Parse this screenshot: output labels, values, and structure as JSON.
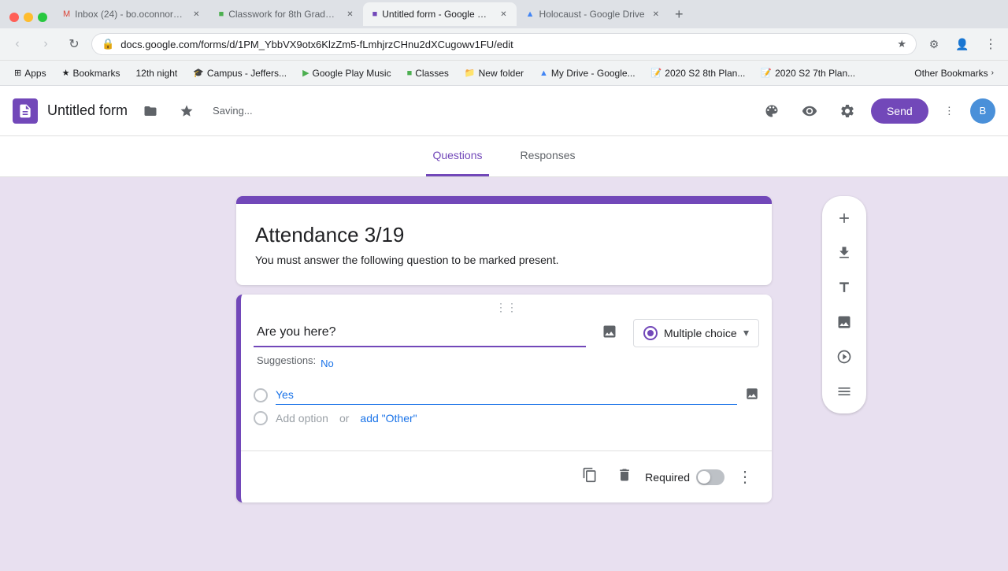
{
  "browser": {
    "window_controls": [
      "close",
      "minimize",
      "maximize"
    ],
    "tabs": [
      {
        "label": "Inbox (24) - bo.oconnor@rmae...",
        "icon": "gmail-icon",
        "active": false
      },
      {
        "label": "Classwork for 8th Grade Engl...",
        "icon": "classroom-icon",
        "active": false
      },
      {
        "label": "Untitled form - Google Forms",
        "icon": "forms-icon",
        "active": true
      },
      {
        "label": "Holocaust - Google Drive",
        "icon": "drive-icon",
        "active": false
      }
    ],
    "url": "docs.google.com/forms/d/1PM_YbbVX9otx6KlzZm5-fLmhjrzCHnu2dXCugowv1FU/edit",
    "bookmarks": [
      {
        "label": "Apps"
      },
      {
        "label": "Bookmarks"
      },
      {
        "label": "12th night"
      },
      {
        "label": "Campus - Jeffers..."
      },
      {
        "label": "Google Play Music"
      },
      {
        "label": "Classes"
      },
      {
        "label": "New folder"
      },
      {
        "label": "My Drive - Google..."
      },
      {
        "label": "2020 S2 8th Plan..."
      },
      {
        "label": "2020 S2 7th Plan..."
      },
      {
        "label": "Other Bookmarks"
      }
    ]
  },
  "header": {
    "title": "Untitled form",
    "saving_text": "Saving...",
    "send_label": "Send"
  },
  "tabs": {
    "questions_label": "Questions",
    "responses_label": "Responses",
    "active": "questions"
  },
  "form": {
    "title": "Attendance 3/19",
    "description": "You must answer the following question to be marked present."
  },
  "question": {
    "text": "Are you here?",
    "type": "Multiple choice",
    "suggestions_label": "Suggestions:",
    "suggestion_option": "No",
    "options": [
      {
        "text": "Yes"
      }
    ],
    "add_option_label": "Add option",
    "add_option_or": "or",
    "add_other_label": "add \"Other\"",
    "required_label": "Required",
    "drag_handle": "⠿"
  },
  "sidebar": {
    "add_icon": "+",
    "import_icon": "⬆",
    "text_icon": "T",
    "image_icon": "🖼",
    "video_icon": "▶",
    "section_icon": "☰"
  }
}
